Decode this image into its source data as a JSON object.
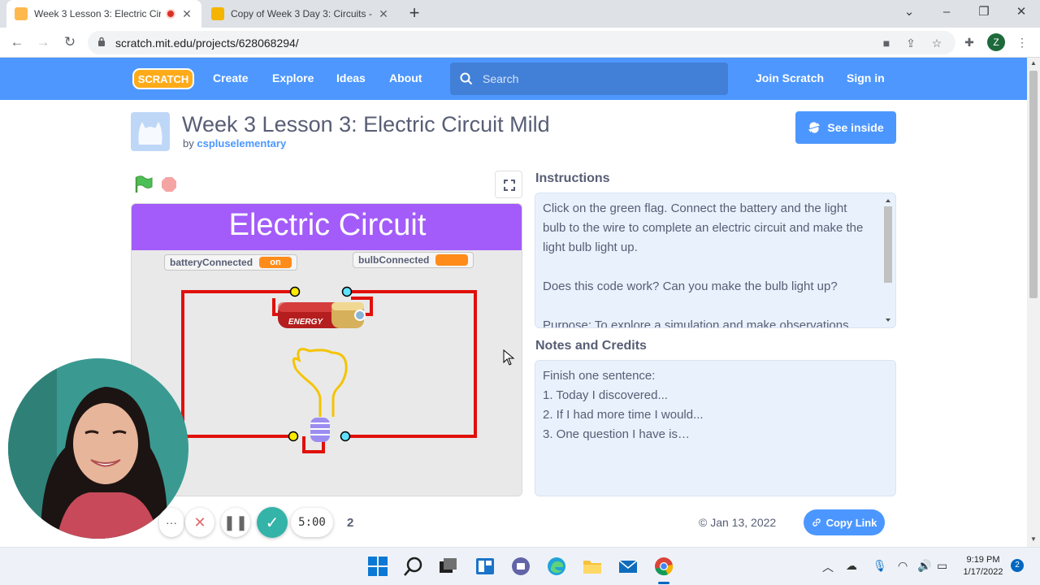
{
  "browser": {
    "tabs": [
      {
        "title": "Week 3 Lesson 3: Electric Circ",
        "active": true
      },
      {
        "title": "Copy of Week 3 Day 3: Circuits -",
        "active": false
      }
    ],
    "url": "scratch.mit.edu/projects/628068294/",
    "profile_initial": "Z"
  },
  "nav": {
    "logo": "SCRATCH",
    "links": [
      "Create",
      "Explore",
      "Ideas",
      "About"
    ],
    "search_placeholder": "Search",
    "join": "Join Scratch",
    "signin": "Sign in"
  },
  "project": {
    "title": "Week 3 Lesson 3: Electric Circuit Mild",
    "by": "by",
    "author": "cspluselementary",
    "see_inside": "See inside",
    "date": "Jan 13, 2022",
    "copy_link": "Copy Link"
  },
  "stage": {
    "banner": "Electric Circuit",
    "monitors": [
      {
        "label": "batteryConnected",
        "value": "on"
      },
      {
        "label": "bulbConnected",
        "value": ""
      }
    ],
    "battery_label": "ENERGY",
    "colors": {
      "wire": "#e0100c",
      "banner": "#a35cf9",
      "monitor": "#ff8c1a"
    }
  },
  "instructions": {
    "heading": "Instructions",
    "paragraphs": [
      "Click on the green flag. Connect the battery and the light bulb to the wire to complete an electric circuit and make the light bulb light up.",
      "Does this code work? Can you make the bulb light up?",
      "Purpose: To explore a simulation and make observations"
    ]
  },
  "notes": {
    "heading": "Notes and Credits",
    "lines": [
      "Finish one sentence:",
      "1. Today I discovered...",
      "2. If I had more time I would...",
      "3. One question I have is…"
    ]
  },
  "recorder": {
    "timer": "5:00",
    "count": "2"
  },
  "taskbar": {
    "time": "9:19 PM",
    "date": "1/17/2022",
    "notifications": "2"
  }
}
